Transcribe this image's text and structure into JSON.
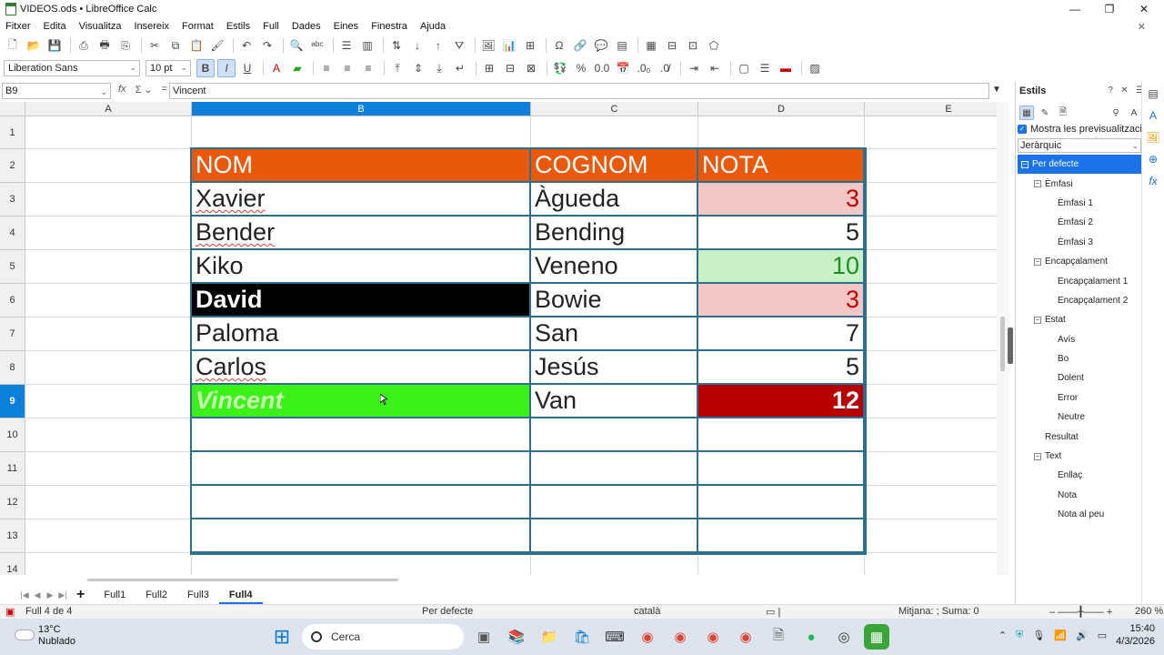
{
  "window": {
    "title": "VIDEOS.ods • LibreOffice Calc"
  },
  "menu": [
    "Fitxer",
    "Edita",
    "Visualitza",
    "Insereix",
    "Format",
    "Estils",
    "Full",
    "Dades",
    "Eines",
    "Finestra",
    "Ajuda"
  ],
  "format_toolbar": {
    "font_name": "Liberation Sans",
    "font_size": "10 pt"
  },
  "formula_bar": {
    "name_box": "B9",
    "content": "Vincent"
  },
  "columns": [
    "A",
    "B",
    "C",
    "D",
    "E"
  ],
  "selected_column": "B",
  "rows": [
    "1",
    "2",
    "3",
    "4",
    "5",
    "6",
    "7",
    "8",
    "9",
    "10",
    "11",
    "12",
    "13",
    "14"
  ],
  "selected_row": "9",
  "table": {
    "headers": [
      "NOM",
      "COGNOM",
      "NOTA"
    ],
    "rows": [
      {
        "nom": "Xavier",
        "cognom": "Àgueda",
        "nota": "3"
      },
      {
        "nom": "Bender",
        "cognom": "Bending",
        "nota": "5"
      },
      {
        "nom": "Kiko",
        "cognom": "Veneno",
        "nota": "10"
      },
      {
        "nom": "David",
        "cognom": "Bowie",
        "nota": "3"
      },
      {
        "nom": "Paloma",
        "cognom": "San",
        "nota": "7"
      },
      {
        "nom": "Carlos",
        "cognom": "Jesús",
        "nota": "5"
      },
      {
        "nom": "Vincent",
        "cognom": "Van",
        "nota": "12"
      }
    ]
  },
  "sheets": [
    "Full1",
    "Full2",
    "Full3",
    "Full4"
  ],
  "active_sheet": "Full4",
  "status": {
    "sheet_info": "Full 4 de 4",
    "page_style": "Per defecte",
    "language": "català",
    "summary": "Mitjana: ; Suma: 0",
    "zoom": "260 %"
  },
  "sidebar": {
    "title": "Estils",
    "preview_label": "Mostra les previsualitzacions",
    "filter": "Jeràrquic",
    "styles": [
      {
        "label": "Per defecte",
        "level": 0,
        "selected": true,
        "expander": "minus"
      },
      {
        "label": "Èmfasi",
        "level": 1,
        "expander": "minus"
      },
      {
        "label": "Èmfasi 1",
        "level": 2
      },
      {
        "label": "Èmfasi 2",
        "level": 2
      },
      {
        "label": "Èmfasi 3",
        "level": 2
      },
      {
        "label": "Encapçalament",
        "level": 1,
        "expander": "minus"
      },
      {
        "label": "Encapçalament 1",
        "level": 2
      },
      {
        "label": "Encapçalament 2",
        "level": 2
      },
      {
        "label": "Estat",
        "level": 1,
        "expander": "minus"
      },
      {
        "label": "Avís",
        "level": 2
      },
      {
        "label": "Bo",
        "level": 2
      },
      {
        "label": "Dolent",
        "level": 2
      },
      {
        "label": "Error",
        "level": 2
      },
      {
        "label": "Neutre",
        "level": 2
      },
      {
        "label": "Resultat",
        "level": 1
      },
      {
        "label": "Text",
        "level": 1,
        "expander": "minus"
      },
      {
        "label": "Enllaç",
        "level": 2
      },
      {
        "label": "Nota",
        "level": 2
      },
      {
        "label": "Nota al peu",
        "level": 2
      }
    ]
  },
  "taskbar": {
    "weather_temp": "13°C",
    "weather_desc": "Nublado",
    "search_placeholder": "Cerca",
    "time": "15:40",
    "date": "4/3/2026"
  },
  "colors": {
    "header_orange": "#e8590c",
    "bad_bg": "#f4c7c7",
    "good_bg": "#c9f0c9",
    "selection_blue": "#0c7fd8",
    "table_border": "#2c6f8f"
  }
}
